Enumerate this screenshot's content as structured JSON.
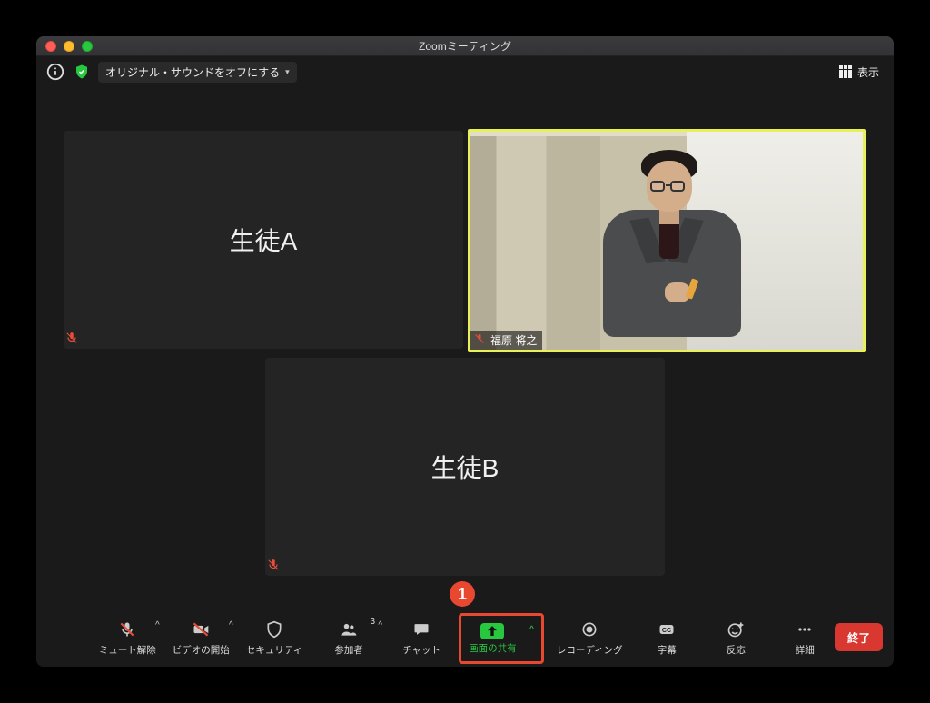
{
  "window": {
    "title": "Zoomミーティング"
  },
  "subbar": {
    "original_sound_label": "オリジナル・サウンドをオフにする",
    "view_label": "表示"
  },
  "tiles": {
    "a": {
      "label": "生徒A"
    },
    "b": {
      "label": "生徒B"
    },
    "speaker": {
      "name": "福原 将之"
    }
  },
  "annotation": {
    "marker1": "1"
  },
  "toolbar": {
    "unmute": "ミュート解除",
    "start_video": "ビデオの開始",
    "security": "セキュリティ",
    "participants": "参加者",
    "participants_count": "3",
    "chat": "チャット",
    "share": "画面の共有",
    "record": "レコーディング",
    "captions": "字幕",
    "reactions": "反応",
    "more": "詳細",
    "end": "終了"
  }
}
